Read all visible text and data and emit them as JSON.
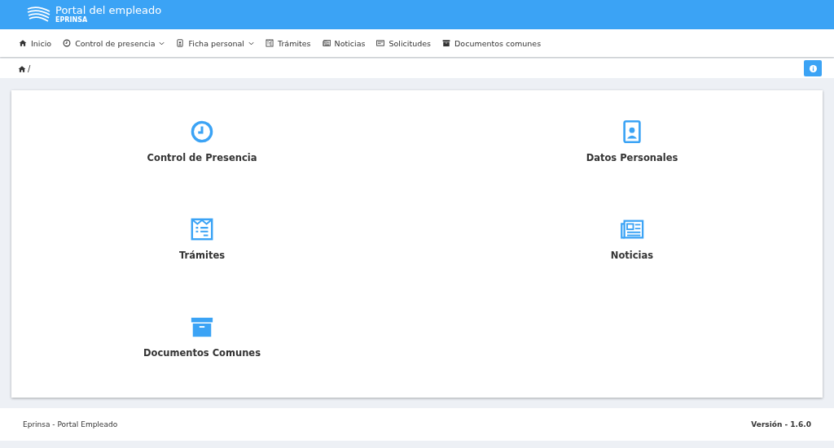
{
  "header": {
    "title": "Portal del empleado",
    "subtitle": "EPRINSA"
  },
  "nav": [
    {
      "label": "Inicio",
      "dropdown": false
    },
    {
      "label": "Control de presencia",
      "dropdown": true
    },
    {
      "label": "Ficha personal",
      "dropdown": true
    },
    {
      "label": "Trámites",
      "dropdown": false
    },
    {
      "label": "Noticias",
      "dropdown": false
    },
    {
      "label": "Solicitudes",
      "dropdown": false
    },
    {
      "label": "Documentos comunes",
      "dropdown": false
    }
  ],
  "breadcrumb": {
    "separator": "/"
  },
  "tiles": [
    {
      "label": "Control de Presencia"
    },
    {
      "label": "Datos Personales"
    },
    {
      "label": "Trámites"
    },
    {
      "label": "Noticias"
    },
    {
      "label": "Documentos Comunes"
    }
  ],
  "footer": {
    "left": "Eprinsa - Portal Empleado",
    "version": "Versión - 1.6.0"
  }
}
